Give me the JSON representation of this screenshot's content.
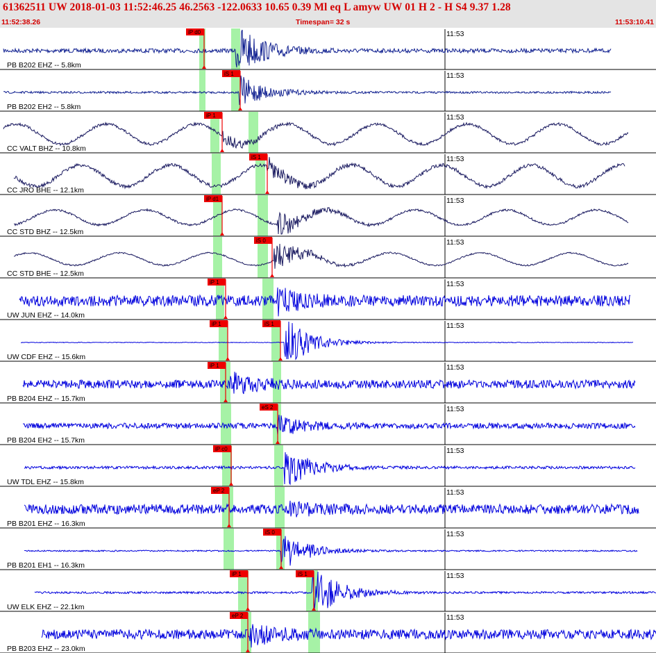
{
  "header": {
    "title": "61362511 UW 2018-01-03 11:52:46.25   46.2563 -122.0633  10.65  0.39 Ml  eq  L amyw     UW 01  H   2  -  H S4    9.37  1.28",
    "start_time": "11:52:38.26",
    "timespan": "Timespan=  32 s",
    "end_time": "11:53:10.41"
  },
  "minute_tick": "11:53",
  "colors": {
    "background": "#ffffff",
    "header_bg": "#e4e4e4",
    "header_text": "#d40000",
    "trace_blue": "#0000dd",
    "trace_navy": "#1a1a60",
    "pick_marker": "#ee0000",
    "pick_window": "#a6f2a6",
    "separator": "#000000"
  },
  "channels": [
    {
      "label": "PB B202 EHZ -- 5.8km",
      "color": "navy_blue",
      "picks": [
        {
          "text": "iP d0",
          "type": "P"
        }
      ]
    },
    {
      "label": "PB B202 EH2 -- 5.8km",
      "color": "navy_blue",
      "picks": [
        {
          "text": "iS 1",
          "type": "S"
        }
      ]
    },
    {
      "label": "CC VALT BHZ -- 10.8km",
      "color": "navy",
      "picks": [
        {
          "text": "iP 1",
          "type": "P"
        }
      ]
    },
    {
      "label": "CC JRO BHE -- 12.1km",
      "color": "navy",
      "picks": [
        {
          "text": "iS 1",
          "type": "S"
        }
      ]
    },
    {
      "label": "CC STD BHZ -- 12.5km",
      "color": "navy",
      "picks": [
        {
          "text": "iP d1",
          "type": "P"
        }
      ]
    },
    {
      "label": "CC STD BHE -- 12.5km",
      "color": "navy",
      "picks": [
        {
          "text": "iS 0",
          "type": "S"
        }
      ]
    },
    {
      "label": "UW JUN EHZ -- 14.0km",
      "color": "blue",
      "picks": [
        {
          "text": "iP 1",
          "type": "P"
        }
      ]
    },
    {
      "label": "UW CDF EHZ -- 15.6km",
      "color": "blue",
      "picks": [
        {
          "text": "iP 1",
          "type": "P"
        },
        {
          "text": "iS 1",
          "type": "S"
        }
      ]
    },
    {
      "label": "PB B204 EHZ -- 15.7km",
      "color": "blue",
      "picks": [
        {
          "text": "iP 1",
          "type": "P"
        }
      ]
    },
    {
      "label": "PB B204 EH2 -- 15.7km",
      "color": "blue",
      "picks": [
        {
          "text": "eS 2",
          "type": "S"
        }
      ]
    },
    {
      "label": "UW TDL EHZ -- 15.8km",
      "color": "blue",
      "picks": [
        {
          "text": "iP c0",
          "type": "P"
        }
      ]
    },
    {
      "label": "PB B201 EHZ -- 16.3km",
      "color": "blue",
      "picks": [
        {
          "text": "eP 2",
          "type": "P"
        }
      ]
    },
    {
      "label": "PB B201 EH1 -- 16.3km",
      "color": "blue",
      "picks": [
        {
          "text": "iS 0",
          "type": "S"
        }
      ]
    },
    {
      "label": "UW ELK EHZ -- 22.1km",
      "color": "blue",
      "picks": [
        {
          "text": "iP 1",
          "type": "P"
        },
        {
          "text": "iS 1",
          "type": "S"
        }
      ]
    },
    {
      "label": "PB B203 EHZ -- 23.0km",
      "color": "blue",
      "picks": [
        {
          "text": "eP 2",
          "type": "P"
        }
      ]
    }
  ]
}
